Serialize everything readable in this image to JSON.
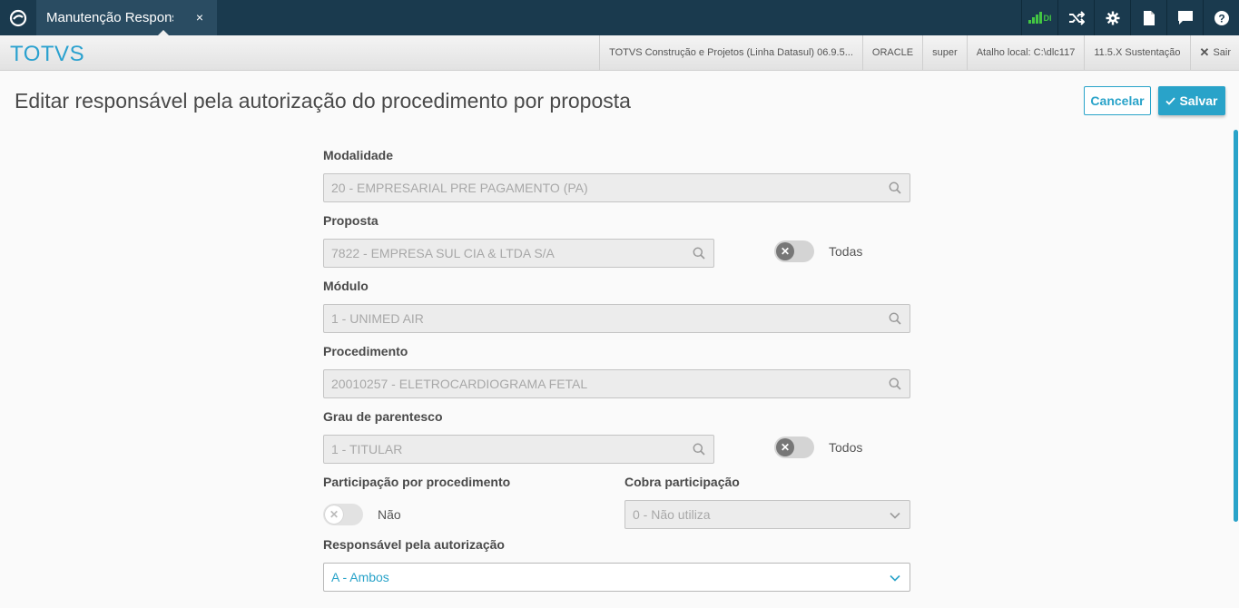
{
  "topbar": {
    "tab_label": "Manutenção Responsável",
    "tab_close": "×",
    "signal_label": "DI",
    "icons": [
      "signal-icon",
      "shuffle-icon",
      "gear-icon",
      "document-icon",
      "chat-icon",
      "help-icon"
    ]
  },
  "secbar": {
    "brand": "TOTVS",
    "product": "TOTVS Construção e Projetos (Linha Datasul) 06.9.5...",
    "database": "ORACLE",
    "user": "super",
    "shortcut": "Atalho local: C:\\dlc117",
    "version": "11.5.X Sustentação",
    "exit_label": "Sair"
  },
  "header": {
    "title": "Editar responsável pela autorização do procedimento por proposta",
    "cancel_label": "Cancelar",
    "save_label": "Salvar"
  },
  "form": {
    "modalidade": {
      "label": "Modalidade",
      "value": "20 - EMPRESARIAL PRE PAGAMENTO (PA)"
    },
    "proposta": {
      "label": "Proposta",
      "value": "7822 - EMPRESA SUL CIA & LTDA S/A",
      "toggle_label": "Todas"
    },
    "modulo": {
      "label": "Módulo",
      "value": "1 - UNIMED AIR"
    },
    "procedimento": {
      "label": "Procedimento",
      "value": "20010257 - ELETROCARDIOGRAMA FETAL"
    },
    "grau": {
      "label": "Grau de parentesco",
      "value": "1 - TITULAR",
      "toggle_label": "Todos"
    },
    "participacao": {
      "label": "Participação por procedimento",
      "toggle_label": "Não"
    },
    "cobra": {
      "label": "Cobra participação",
      "value": "0 - Não utiliza"
    },
    "responsavel": {
      "label": "Responsável pela autorização",
      "value": "A - Ambos"
    }
  },
  "colors": {
    "accent": "#29a3c9",
    "topbar": "#1a3a4e",
    "signal": "#43c643"
  }
}
